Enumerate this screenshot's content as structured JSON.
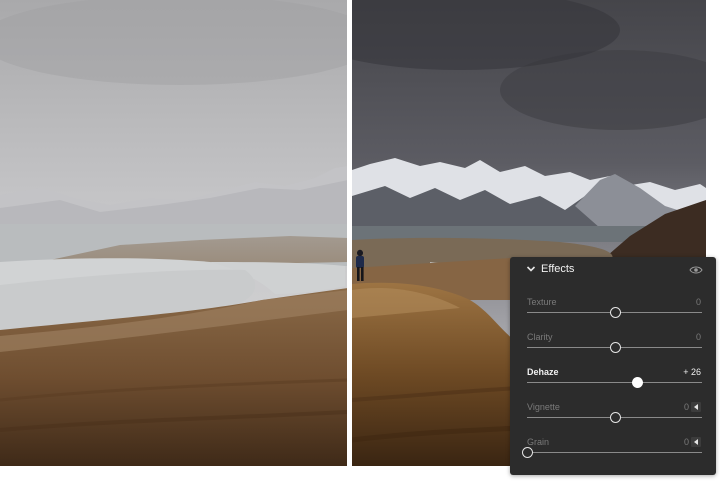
{
  "panel": {
    "title": "Effects",
    "collapse_icon": "chevron-down-icon",
    "visibility_icon": "eye-icon",
    "sliders": [
      {
        "label": "Texture",
        "value": "0",
        "level": 0.5,
        "active": false,
        "has_button": false
      },
      {
        "label": "Clarity",
        "value": "0",
        "level": 0.5,
        "active": false,
        "has_button": false
      },
      {
        "label": "Dehaze",
        "value": "+ 26",
        "level": 0.63,
        "active": true,
        "has_button": false
      },
      {
        "label": "Vignette",
        "value": "0",
        "level": 0.5,
        "active": false,
        "has_button": true
      },
      {
        "label": "Grain",
        "value": "0",
        "level": 0.0,
        "active": false,
        "has_button": true
      }
    ]
  },
  "colors": {
    "panel_bg": "#2c2c2c",
    "label_dim": "#7a7a7a",
    "label_active": "#f0f0f0"
  }
}
